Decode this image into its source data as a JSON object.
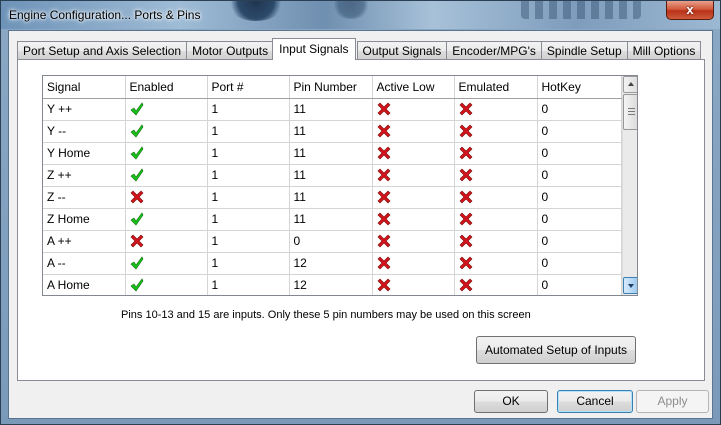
{
  "window": {
    "title": "Engine Configuration... Ports & Pins",
    "close_label": "x"
  },
  "tabs": [
    {
      "label": "Port Setup and Axis Selection",
      "active": false
    },
    {
      "label": "Motor Outputs",
      "active": false
    },
    {
      "label": "Input Signals",
      "active": true
    },
    {
      "label": "Output Signals",
      "active": false
    },
    {
      "label": "Encoder/MPG's",
      "active": false
    },
    {
      "label": "Spindle Setup",
      "active": false
    },
    {
      "label": "Mill Options",
      "active": false
    }
  ],
  "grid": {
    "columns": [
      "Signal",
      "Enabled",
      "Port #",
      "Pin Number",
      "Active Low",
      "Emulated",
      "HotKey"
    ],
    "rows": [
      {
        "signal": "Y ++",
        "enabled": true,
        "port": "1",
        "pin": "11",
        "active_low": false,
        "emulated": false,
        "hotkey": "0"
      },
      {
        "signal": "Y --",
        "enabled": true,
        "port": "1",
        "pin": "11",
        "active_low": false,
        "emulated": false,
        "hotkey": "0"
      },
      {
        "signal": "Y Home",
        "enabled": true,
        "port": "1",
        "pin": "11",
        "active_low": false,
        "emulated": false,
        "hotkey": "0"
      },
      {
        "signal": "Z ++",
        "enabled": true,
        "port": "1",
        "pin": "11",
        "active_low": false,
        "emulated": false,
        "hotkey": "0"
      },
      {
        "signal": "Z --",
        "enabled": false,
        "port": "1",
        "pin": "11",
        "active_low": false,
        "emulated": false,
        "hotkey": "0"
      },
      {
        "signal": "Z Home",
        "enabled": true,
        "port": "1",
        "pin": "11",
        "active_low": false,
        "emulated": false,
        "hotkey": "0"
      },
      {
        "signal": "A ++",
        "enabled": false,
        "port": "1",
        "pin": "0",
        "active_low": false,
        "emulated": false,
        "hotkey": "0"
      },
      {
        "signal": "A --",
        "enabled": true,
        "port": "1",
        "pin": "12",
        "active_low": false,
        "emulated": false,
        "hotkey": "0"
      },
      {
        "signal": "A Home",
        "enabled": true,
        "port": "1",
        "pin": "12",
        "active_low": false,
        "emulated": false,
        "hotkey": "0"
      }
    ]
  },
  "note": "Pins 10-13 and 15 are inputs. Only these 5 pin numbers may be used on this screen",
  "buttons": {
    "automated_setup": "Automated Setup of Inputs",
    "ok": "OK",
    "cancel": "Cancel",
    "apply": "Apply"
  },
  "colors": {
    "check": "#19c219",
    "cross": "#d4141c"
  }
}
